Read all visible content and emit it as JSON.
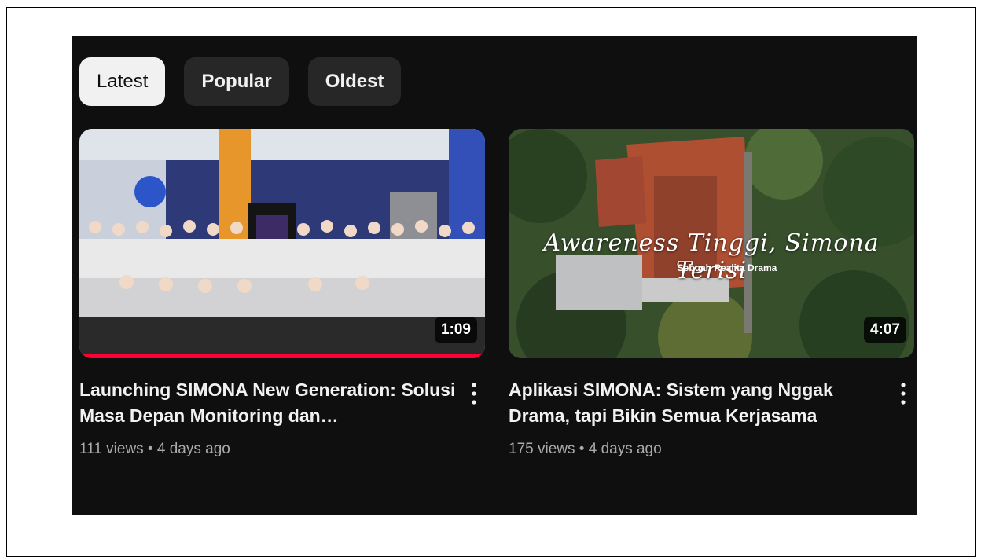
{
  "chips": [
    {
      "label": "Latest",
      "active": true
    },
    {
      "label": "Popular",
      "active": false
    },
    {
      "label": "Oldest",
      "active": false
    }
  ],
  "videos": [
    {
      "title": "Launching SIMONA New Generation: Solusi Masa Depan Monitoring dan…",
      "duration": "1:09",
      "views": "111 views",
      "age": "4 days ago",
      "watched_fraction": 1.0,
      "overlay_title": "",
      "overlay_subtitle": ""
    },
    {
      "title": "Aplikasi SIMONA: Sistem yang Nggak Drama, tapi Bikin Semua Kerjasama",
      "duration": "4:07",
      "views": "175 views",
      "age": "4 days ago",
      "watched_fraction": 0,
      "overlay_title": "Awareness Tinggi, Simona Terisi",
      "overlay_subtitle": "Sebuah Realita Drama"
    }
  ],
  "meta_separator": "•",
  "icons": {
    "more": "more-vert-icon"
  },
  "colors": {
    "panel": "#0f0f0f",
    "chip": "#272727",
    "chip_active": "#f1f1f1",
    "progress": "#ff0033",
    "secondary_text": "#aaaaaa"
  }
}
